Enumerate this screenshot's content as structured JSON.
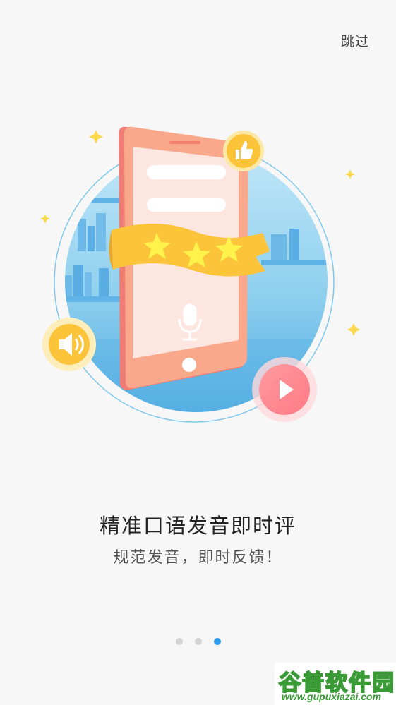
{
  "header": {
    "skip_label": "跳过"
  },
  "illustration": {
    "stars": [
      "star-icon",
      "star-icon",
      "star-icon"
    ],
    "colors": {
      "circle": "#7fc8ec",
      "phone": "#f79a84",
      "ribbon": "#fcc43a",
      "play_button": "#ff8f95"
    }
  },
  "content": {
    "title": "精准口语发音即时评",
    "subtitle": "规范发音，即时反馈！"
  },
  "pagination": {
    "total": 3,
    "active_index": 2,
    "active_color": "#2d9cf0"
  },
  "watermark": {
    "logo_text": "谷普软件园",
    "url_text": "www.gupuxiazai.com"
  }
}
